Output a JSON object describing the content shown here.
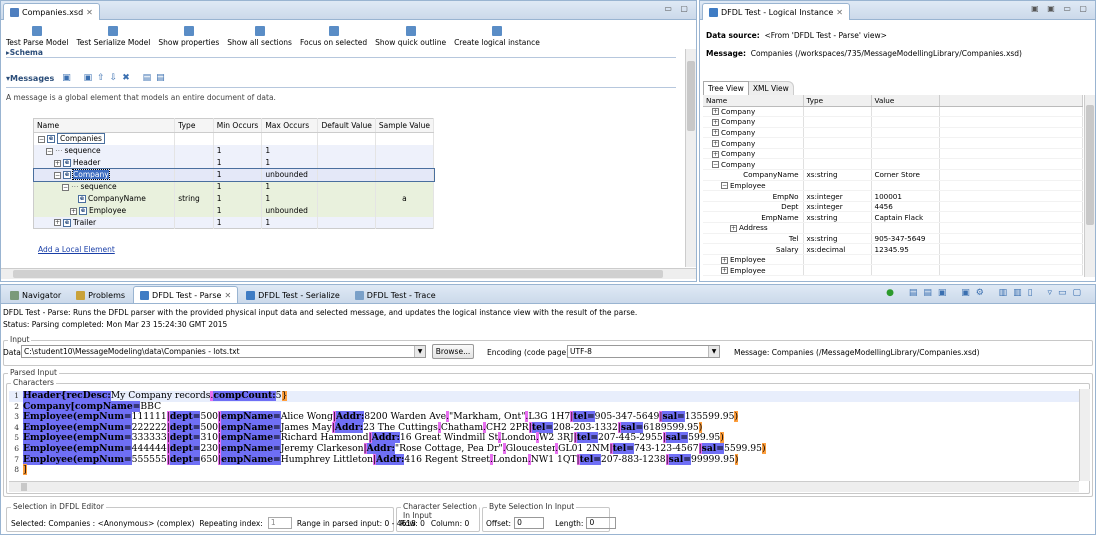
{
  "editor": {
    "tab_title": "Companies.xsd",
    "toolbar": [
      "Test Parse Model",
      "Test Serialize Model",
      "Show properties",
      "Show all sections",
      "Focus on selected",
      "Show quick outline",
      "Create logical instance"
    ],
    "schema_header": "▸Schema",
    "messages_header": "▾Messages",
    "messages_desc": "A message is a global element that models an entire document of data.",
    "columns": [
      "Name",
      "Type",
      "Min Occurs",
      "Max Occurs",
      "Default Value",
      "Sample Value"
    ],
    "rows": [
      {
        "name": "Companies",
        "type": "",
        "min": "",
        "max": "",
        "default": "",
        "sample": ""
      },
      {
        "name": "sequence",
        "type": "",
        "min": "1",
        "max": "1",
        "default": "",
        "sample": ""
      },
      {
        "name": "Header",
        "type": "",
        "min": "1",
        "max": "1",
        "default": "",
        "sample": ""
      },
      {
        "name": "Company",
        "type": "",
        "min": "1",
        "max": "unbounded",
        "default": "",
        "sample": ""
      },
      {
        "name": "sequence",
        "type": "",
        "min": "1",
        "max": "1",
        "default": "",
        "sample": ""
      },
      {
        "name": "CompanyName",
        "type": "string",
        "min": "1",
        "max": "1",
        "default": "",
        "sample": "a"
      },
      {
        "name": "Employee",
        "type": "",
        "min": "1",
        "max": "unbounded",
        "default": "",
        "sample": ""
      },
      {
        "name": "Trailer",
        "type": "",
        "min": "1",
        "max": "1",
        "default": "",
        "sample": ""
      }
    ],
    "add_link": "Add a Local Element"
  },
  "logical": {
    "tab_title": "DFDL Test - Logical Instance",
    "source_label": "Data source:",
    "source_value": "<From 'DFDL Test - Parse' view>",
    "message_label": "Message:",
    "message_value": "Companies (/workspaces/735/MessageModellingLibrary/Companies.xsd)",
    "tabs": [
      "Tree View",
      "XML View"
    ],
    "columns": [
      "Name",
      "Type",
      "Value"
    ],
    "rows": [
      {
        "name": "Company",
        "type": "",
        "value": "",
        "exp": "+",
        "indent": 1
      },
      {
        "name": "Company",
        "type": "",
        "value": "",
        "exp": "+",
        "indent": 1
      },
      {
        "name": "Company",
        "type": "",
        "value": "",
        "exp": "+",
        "indent": 1
      },
      {
        "name": "Company",
        "type": "",
        "value": "",
        "exp": "+",
        "indent": 1
      },
      {
        "name": "Company",
        "type": "",
        "value": "",
        "exp": "+",
        "indent": 1
      },
      {
        "name": "Company",
        "type": "",
        "value": "",
        "exp": "−",
        "indent": 1
      },
      {
        "name": "CompanyName",
        "type": "xs:string",
        "value": "Corner Store",
        "exp": "",
        "indent": 3
      },
      {
        "name": "Employee",
        "type": "",
        "value": "",
        "exp": "−",
        "indent": 2
      },
      {
        "name": "EmpNo",
        "type": "xs:integer",
        "value": "100001",
        "exp": "",
        "indent": 4
      },
      {
        "name": "Dept",
        "type": "xs:integer",
        "value": "4456",
        "exp": "",
        "indent": 4
      },
      {
        "name": "EmpName",
        "type": "xs:string",
        "value": "Captain Flack",
        "exp": "",
        "indent": 4
      },
      {
        "name": "Address",
        "type": "",
        "value": "",
        "exp": "+",
        "indent": 3
      },
      {
        "name": "Tel",
        "type": "xs:string",
        "value": "905-347-5649",
        "exp": "",
        "indent": 4
      },
      {
        "name": "Salary",
        "type": "xs:decimal",
        "value": "12345.95",
        "exp": "",
        "indent": 4
      },
      {
        "name": "Employee",
        "type": "",
        "value": "",
        "exp": "+",
        "indent": 2
      },
      {
        "name": "Employee",
        "type": "",
        "value": "",
        "exp": "+",
        "indent": 2
      }
    ]
  },
  "bottom": {
    "tabs": [
      "Navigator",
      "Problems",
      "DFDL Test - Parse",
      "DFDL Test - Serialize",
      "DFDL Test - Trace"
    ],
    "description": "DFDL Test - Parse:  Runs the DFDL parser with the provided physical input data and selected message, and updates the logical instance view with the result of the parse.",
    "status": "Status:  Parsing completed: Mon Mar 23 15:24:30 GMT 2015",
    "input_group": "Input",
    "data_label": "Data:",
    "data_value": "C:\\student10\\MessageModeling\\data\\Companies - lots.txt",
    "browse": "Browse...",
    "encoding_label": "Encoding (code page):",
    "encoding_value": "UTF-8",
    "message_info": "Message:  Companies (/MessageModellingLibrary/Companies.xsd)",
    "parsed_group": "Parsed Input",
    "characters_group": "Characters",
    "lines": [
      [
        [
          "m",
          "Header{recDesc:"
        ],
        [
          "",
          "My Company records"
        ],
        [
          "d",
          "."
        ],
        [
          "m",
          "compCount:"
        ],
        [
          "",
          "5"
        ],
        [
          "t",
          "}"
        ]
      ],
      [
        [
          "m",
          "Company[compName="
        ],
        [
          "",
          "BBC"
        ]
      ],
      [
        [
          "m",
          "Employee(empNum="
        ],
        [
          "",
          "111111"
        ],
        [
          "d",
          "|"
        ],
        [
          "m",
          "dept="
        ],
        [
          "",
          "500"
        ],
        [
          "d",
          "|"
        ],
        [
          "m",
          "empName="
        ],
        [
          "",
          "Alice Wong"
        ],
        [
          "d",
          "|"
        ],
        [
          "m",
          "Addr:"
        ],
        [
          "",
          "8200 Warden Ave"
        ],
        [
          "d",
          "."
        ],
        [
          "",
          "\"Markham, Ont\""
        ],
        [
          "d",
          "."
        ],
        [
          "",
          "L3G 1H7"
        ],
        [
          "d",
          "|"
        ],
        [
          "m",
          "tel="
        ],
        [
          "",
          "905-347-5649"
        ],
        [
          "d",
          "|"
        ],
        [
          "m",
          "sal="
        ],
        [
          "",
          "135599.95"
        ],
        [
          "t",
          ")"
        ]
      ],
      [
        [
          "m",
          "Employee(empNum="
        ],
        [
          "",
          "222222"
        ],
        [
          "d",
          "|"
        ],
        [
          "m",
          "dept="
        ],
        [
          "",
          "500"
        ],
        [
          "d",
          "|"
        ],
        [
          "m",
          "empName="
        ],
        [
          "",
          "James May"
        ],
        [
          "d",
          "|"
        ],
        [
          "m",
          "Addr:"
        ],
        [
          "",
          "23 The Cuttings"
        ],
        [
          "d",
          "."
        ],
        [
          "",
          "Chatham"
        ],
        [
          "d",
          "."
        ],
        [
          "",
          "CH2 2PR"
        ],
        [
          "d",
          "|"
        ],
        [
          "m",
          "tel="
        ],
        [
          "",
          "208-203-1332"
        ],
        [
          "d",
          "|"
        ],
        [
          "m",
          "sal="
        ],
        [
          "",
          "6189599.95"
        ],
        [
          "t",
          ")"
        ]
      ],
      [
        [
          "m",
          "Employee(empNum="
        ],
        [
          "",
          "333333"
        ],
        [
          "d",
          "|"
        ],
        [
          "m",
          "dept="
        ],
        [
          "",
          "310"
        ],
        [
          "d",
          "|"
        ],
        [
          "m",
          "empName="
        ],
        [
          "",
          "Richard Hammond"
        ],
        [
          "d",
          "|"
        ],
        [
          "m",
          "Addr:"
        ],
        [
          "",
          "16 Great Windmill St"
        ],
        [
          "d",
          "."
        ],
        [
          "",
          "London"
        ],
        [
          "d",
          "."
        ],
        [
          "",
          "W2 3RJ"
        ],
        [
          "d",
          "|"
        ],
        [
          "m",
          "tel="
        ],
        [
          "",
          "207-445-2955"
        ],
        [
          "d",
          "|"
        ],
        [
          "m",
          "sal="
        ],
        [
          "",
          "599.95"
        ],
        [
          "t",
          ")"
        ]
      ],
      [
        [
          "m",
          "Employee(empNum="
        ],
        [
          "",
          "444444"
        ],
        [
          "d",
          "|"
        ],
        [
          "m",
          "dept="
        ],
        [
          "",
          "230"
        ],
        [
          "d",
          "|"
        ],
        [
          "m",
          "empName="
        ],
        [
          "",
          "Jeremy Clarkeson"
        ],
        [
          "d",
          "|"
        ],
        [
          "m",
          "Addr:"
        ],
        [
          "",
          "\"Rose Cottage, Pea Dr\""
        ],
        [
          "d",
          "."
        ],
        [
          "",
          "Gloucester"
        ],
        [
          "d",
          "."
        ],
        [
          "",
          "GL01 2NM"
        ],
        [
          "d",
          "|"
        ],
        [
          "m",
          "tel="
        ],
        [
          "",
          "743-123-4567"
        ],
        [
          "d",
          "|"
        ],
        [
          "m",
          "sal="
        ],
        [
          "",
          "5599.95"
        ],
        [
          "t",
          ")"
        ]
      ],
      [
        [
          "m",
          "Employee(empNum="
        ],
        [
          "",
          "555555"
        ],
        [
          "d",
          "|"
        ],
        [
          "m",
          "dept="
        ],
        [
          "",
          "650"
        ],
        [
          "d",
          "|"
        ],
        [
          "m",
          "empName="
        ],
        [
          "",
          "Humphrey Littleton"
        ],
        [
          "d",
          "|"
        ],
        [
          "m",
          "Addr:"
        ],
        [
          "",
          "416 Regent Street"
        ],
        [
          "d",
          "."
        ],
        [
          "",
          "London"
        ],
        [
          "d",
          "."
        ],
        [
          "",
          "NW1 1QT"
        ],
        [
          "d",
          "|"
        ],
        [
          "m",
          "tel="
        ],
        [
          "",
          "207-883-1238"
        ],
        [
          "d",
          "|"
        ],
        [
          "m",
          "sal="
        ],
        [
          "",
          "99999.95"
        ],
        [
          "t",
          ")"
        ]
      ],
      [
        [
          "t",
          "]"
        ]
      ]
    ],
    "sel_group": "Selection in DFDL Editor",
    "selected": "Selected: Companies : <Anonymous> (complex)",
    "repeating_label": "Repeating index:",
    "repeating_value": "1",
    "range": "Range in parsed input: 0 - 4618",
    "char_group": "Character Selection In Input",
    "row": "Row: 0",
    "column": "Column: 0",
    "byte_group": "Byte Selection In Input",
    "offset_label": "Offset:",
    "offset_value": "0",
    "length_label": "Length:",
    "length_value": "0"
  },
  "colors": {
    "accent": "#2b4d79",
    "markup": "#6f6ff5",
    "delimiter": "#e86ff0",
    "terminator": "#ff9f3d"
  }
}
